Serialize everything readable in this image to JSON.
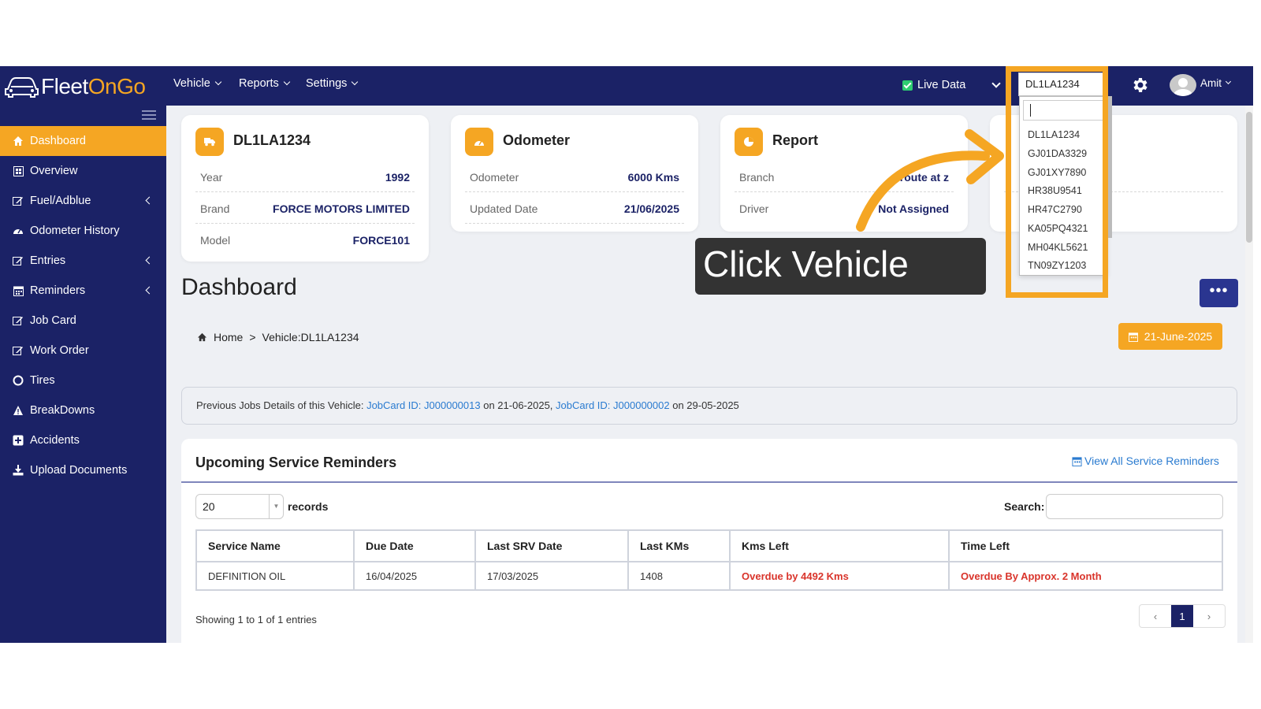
{
  "brand": {
    "part1": "Fleet",
    "part2": "OnGo"
  },
  "nav": [
    {
      "label": "Vehicle"
    },
    {
      "label": "Reports"
    },
    {
      "label": "Settings"
    }
  ],
  "live_data_label": "Live Data",
  "vehicle_select_value": "DL1LA1234",
  "user_name": "Amit",
  "sidebar": [
    {
      "label": "Dashboard",
      "icon": "home-icon"
    },
    {
      "label": "Overview",
      "icon": "grid-icon"
    },
    {
      "label": "Fuel/Adblue",
      "icon": "edit-icon"
    },
    {
      "label": "Odometer History",
      "icon": "gauge-icon"
    },
    {
      "label": "Entries",
      "icon": "edit-icon"
    },
    {
      "label": "Reminders",
      "icon": "calendar-icon"
    },
    {
      "label": "Job Card",
      "icon": "edit-icon"
    },
    {
      "label": "Work Order",
      "icon": "edit-icon"
    },
    {
      "label": "Tires",
      "icon": "circle-icon"
    },
    {
      "label": "BreakDowns",
      "icon": "warning-icon"
    },
    {
      "label": "Accidents",
      "icon": "plus-square-icon"
    },
    {
      "label": "Upload Documents",
      "icon": "download-icon"
    }
  ],
  "cards": {
    "vehicle": {
      "title": "DL1LA1234",
      "rows": [
        {
          "k": "Year",
          "v": "1992"
        },
        {
          "k": "Brand",
          "v": "FORCE MOTORS LIMITED"
        },
        {
          "k": "Model",
          "v": "FORCE101"
        }
      ]
    },
    "odometer": {
      "title": "Odometer",
      "rows": [
        {
          "k": "Odometer",
          "v": "6000 Kms"
        },
        {
          "k": "Updated Date",
          "v": "21/06/2025"
        }
      ]
    },
    "report": {
      "title": "Report",
      "rows": [
        {
          "k": "Branch",
          "v": "route at z"
        },
        {
          "k": "Driver",
          "v": "Not Assigned"
        }
      ]
    }
  },
  "page_title": "Dashboard",
  "breadcrumb": {
    "home": "Home",
    "sep": ">",
    "current": "Vehicle:DL1LA1234"
  },
  "date_button": "21-June-2025",
  "prev_jobs": {
    "prefix": "Previous Jobs Details of this Vehicle:",
    "link1": "JobCard ID: J000000013",
    "mid": "on 21-06-2025,",
    "link2": "JobCard ID: J000000002",
    "suffix": "on 29-05-2025"
  },
  "reminders": {
    "title": "Upcoming Service Reminders",
    "view_all": "View All Service Reminders",
    "records_value": "20",
    "records_label": "records",
    "search_label": "Search:",
    "columns": [
      "Service Name",
      "Due Date",
      "Last SRV Date",
      "Last KMs",
      "Kms Left",
      "Time Left"
    ],
    "rows": [
      [
        "DEFINITION OIL",
        "16/04/2025",
        "17/03/2025",
        "1408",
        "Overdue by 4492 Kms",
        "Overdue By Approx. 2 Month"
      ]
    ],
    "showing": "Showing 1 to 1 of 1 entries",
    "pager": {
      "prev": "‹",
      "current": "1",
      "next": "›"
    }
  },
  "dropdown_options": [
    "DL1LA1234",
    "GJ01DA3329",
    "GJ01XY7890",
    "HR38U9541",
    "HR47C2790",
    "KA05PQ4321",
    "MH04KL5621",
    "TN09ZY1203"
  ],
  "callout": "Click Vehicle",
  "colors": {
    "navy": "#1b2266",
    "accent": "#f5a623",
    "link": "#2a7bd0",
    "danger": "#d9342b"
  }
}
